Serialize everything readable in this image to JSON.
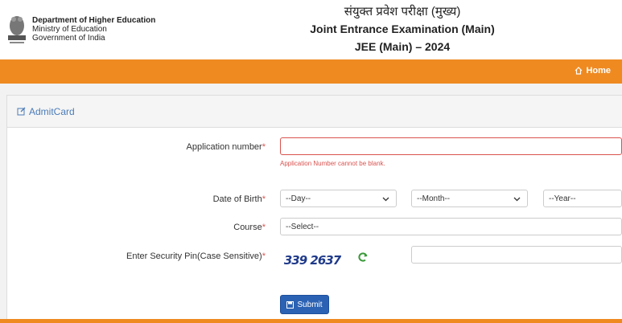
{
  "header": {
    "dept_name": "Department of Higher Education",
    "ministry": "Ministry of Education",
    "govt": "Government of India",
    "title_hindi": "संयुक्त प्रवेश परीक्षा (मुख्य)",
    "title_en": "Joint Entrance Examination (Main)",
    "title_year": "JEE (Main) – 2024"
  },
  "nav": {
    "home_label": "Home"
  },
  "card": {
    "title": "AdmitCard"
  },
  "form": {
    "app_label": "Application number",
    "app_value": "",
    "app_error": "Application Number cannot be blank.",
    "dob_label": "Date of Birth",
    "day_value": "--Day--",
    "month_value": "--Month--",
    "year_value": "--Year--",
    "course_label": "Course",
    "course_value": "--Select--",
    "pin_label": "Enter Security Pin(Case Sensitive)",
    "captcha_text": "339 2637",
    "pin_value": "",
    "required_mark": "*",
    "submit_label": "Submit"
  },
  "colors": {
    "nav_orange": "#ef8a21",
    "link_blue": "#4a7bb7",
    "error_red": "#d9534f",
    "submit_blue": "#2b62b3"
  },
  "icons": [
    "national-emblem-icon",
    "home-icon",
    "edit-icon",
    "chevron-down-icon",
    "refresh-icon",
    "save-icon"
  ]
}
